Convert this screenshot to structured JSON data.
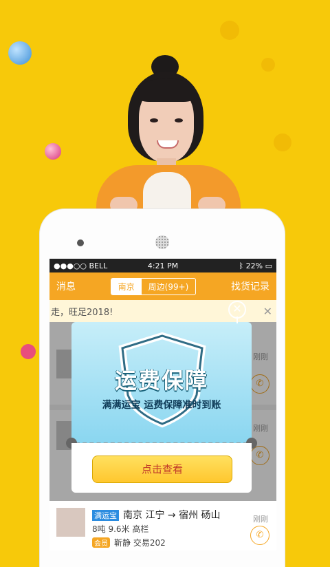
{
  "status_bar": {
    "carrier": "●●●○○ BELL",
    "time": "4:21 PM",
    "battery": "22%"
  },
  "nav": {
    "left": "消息",
    "seg_active": "南京",
    "seg_other": "周边(99+)",
    "right": "找货记录"
  },
  "notice": {
    "text": "走，旺足2018!",
    "close": "✕"
  },
  "list": [
    {
      "time": "刚刚",
      "phone": "✆"
    },
    {
      "time": "刚刚",
      "phone": "✆"
    }
  ],
  "bottom_row": {
    "badge": "满运宝",
    "route": "南京 江宁 → 宿州 砀山",
    "spec": "8吨 9.6米 高栏",
    "member": "会员",
    "user": "靳静 交易202",
    "time": "刚刚",
    "phone": "✆"
  },
  "popup": {
    "title": "运费保障",
    "subtitle": "满满运宝 运费保障准时到账",
    "button": "点击查看",
    "close": "✕"
  },
  "colors": {
    "background": "#f7c90a",
    "nav": "#f5a623",
    "popup_top": "#8ad6f0"
  }
}
